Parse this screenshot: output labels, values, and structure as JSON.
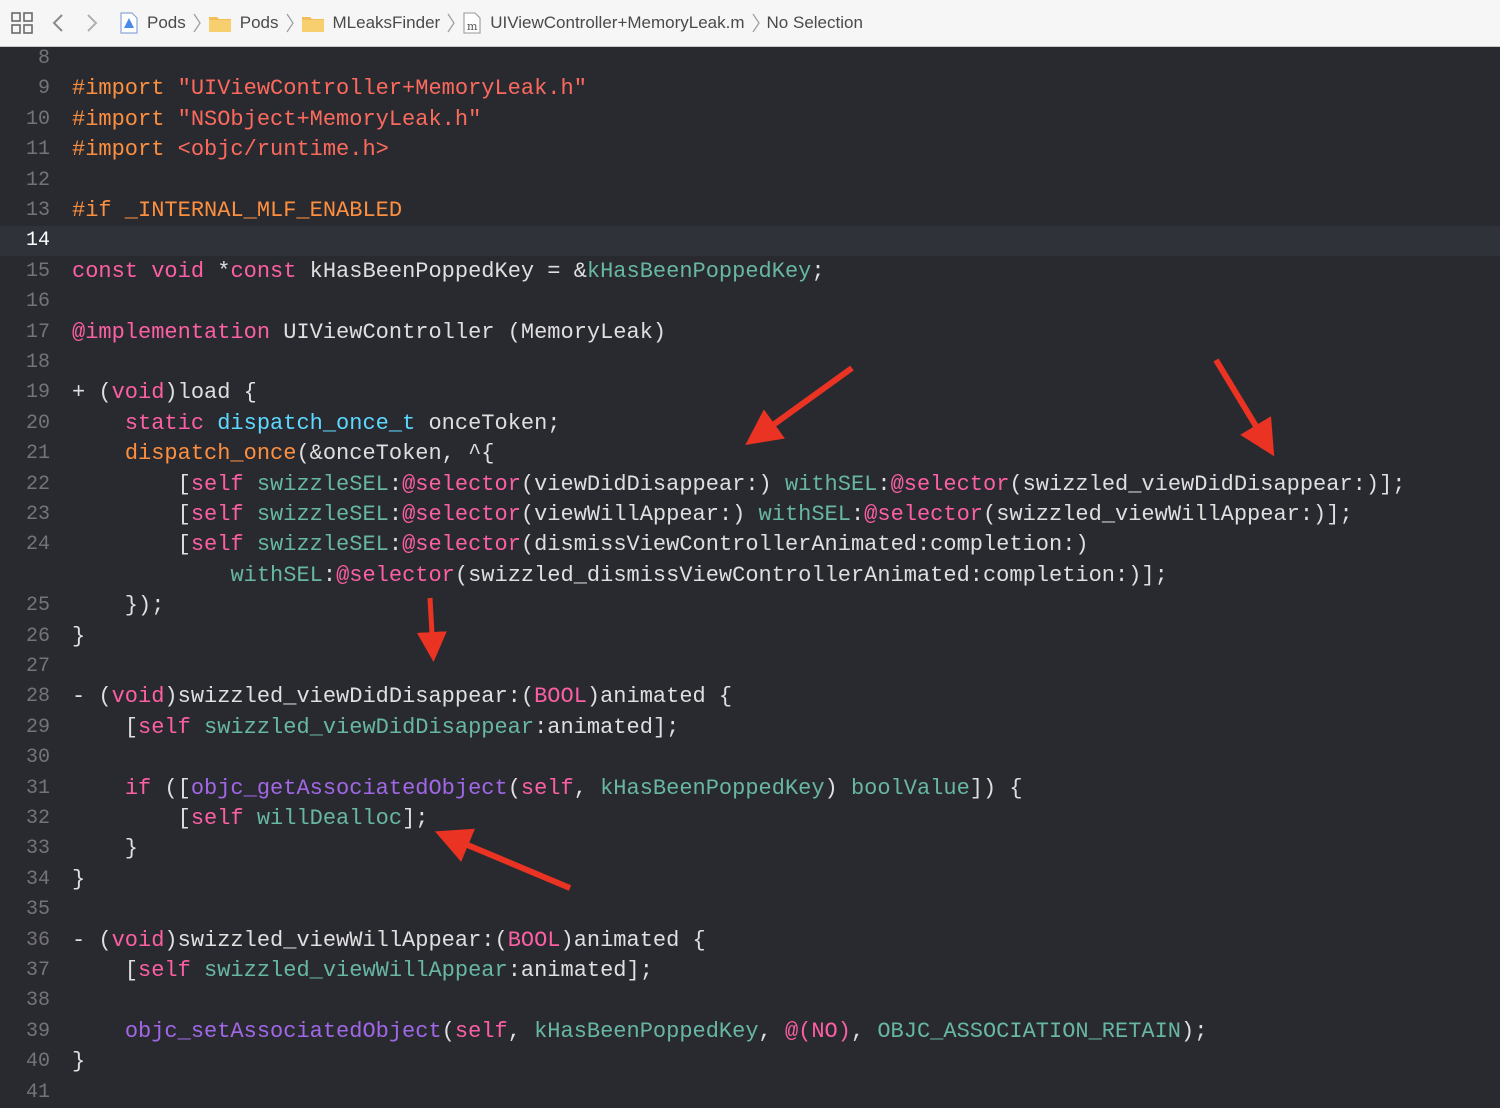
{
  "jumpbar": {
    "crumbs": [
      {
        "label": "Pods",
        "icon": "xcode-project-icon"
      },
      {
        "label": "Pods",
        "icon": "folder-icon"
      },
      {
        "label": "MLeaksFinder",
        "icon": "folder-icon"
      },
      {
        "label": "UIViewController+MemoryLeak.m",
        "icon": "objc-file-icon",
        "icon_letter": "m"
      },
      {
        "label": "No Selection",
        "icon": ""
      }
    ]
  },
  "editor": {
    "current_line": "14",
    "lines": [
      {
        "num": "8",
        "tokens": []
      },
      {
        "num": "9",
        "tokens": [
          [
            "pp",
            "#import "
          ],
          [
            "s",
            "\"UIViewController+MemoryLeak.h\""
          ]
        ]
      },
      {
        "num": "10",
        "tokens": [
          [
            "pp",
            "#import "
          ],
          [
            "s",
            "\"NSObject+MemoryLeak.h\""
          ]
        ]
      },
      {
        "num": "11",
        "tokens": [
          [
            "pp",
            "#import "
          ],
          [
            "s",
            "<objc/runtime.h>"
          ]
        ]
      },
      {
        "num": "12",
        "tokens": []
      },
      {
        "num": "13",
        "tokens": [
          [
            "pp",
            "#if _INTERNAL_MLF_ENABLED"
          ]
        ]
      },
      {
        "num": "14",
        "tokens": []
      },
      {
        "num": "15",
        "tokens": [
          [
            "k",
            "const"
          ],
          [
            "d",
            " "
          ],
          [
            "k",
            "void"
          ],
          [
            "d",
            " *"
          ],
          [
            "k",
            "const"
          ],
          [
            "d",
            " kHasBeenPoppedKey = &"
          ],
          [
            "p",
            "kHasBeenPoppedKey"
          ],
          [
            "d",
            ";"
          ]
        ]
      },
      {
        "num": "16",
        "tokens": []
      },
      {
        "num": "17",
        "tokens": [
          [
            "k",
            "@implementation"
          ],
          [
            "d",
            " UIViewController (MemoryLeak)"
          ]
        ]
      },
      {
        "num": "18",
        "tokens": []
      },
      {
        "num": "19",
        "tokens": [
          [
            "d",
            "+ ("
          ],
          [
            "k",
            "void"
          ],
          [
            "d",
            ")load {"
          ]
        ]
      },
      {
        "num": "20",
        "tokens": [
          [
            "d",
            "    "
          ],
          [
            "k",
            "static"
          ],
          [
            "d",
            " "
          ],
          [
            "t",
            "dispatch_once_t"
          ],
          [
            "d",
            " onceToken;"
          ]
        ]
      },
      {
        "num": "21",
        "tokens": [
          [
            "d",
            "    "
          ],
          [
            "pp",
            "dispatch_once"
          ],
          [
            "d",
            "(&onceToken, ^{"
          ]
        ]
      },
      {
        "num": "22",
        "tokens": [
          [
            "d",
            "        ["
          ],
          [
            "k",
            "self"
          ],
          [
            "d",
            " "
          ],
          [
            "p",
            "swizzleSEL"
          ],
          [
            "d",
            ":"
          ],
          [
            "k",
            "@selector"
          ],
          [
            "d",
            "(viewDidDisappear:) "
          ],
          [
            "p",
            "withSEL"
          ],
          [
            "d",
            ":"
          ],
          [
            "k",
            "@selector"
          ],
          [
            "d",
            "(swizzled_viewDidDisappear:)];"
          ]
        ]
      },
      {
        "num": "23",
        "tokens": [
          [
            "d",
            "        ["
          ],
          [
            "k",
            "self"
          ],
          [
            "d",
            " "
          ],
          [
            "p",
            "swizzleSEL"
          ],
          [
            "d",
            ":"
          ],
          [
            "k",
            "@selector"
          ],
          [
            "d",
            "(viewWillAppear:) "
          ],
          [
            "p",
            "withSEL"
          ],
          [
            "d",
            ":"
          ],
          [
            "k",
            "@selector"
          ],
          [
            "d",
            "(swizzled_viewWillAppear:)];"
          ]
        ]
      },
      {
        "num": "24",
        "tokens": [
          [
            "d",
            "        ["
          ],
          [
            "k",
            "self"
          ],
          [
            "d",
            " "
          ],
          [
            "p",
            "swizzleSEL"
          ],
          [
            "d",
            ":"
          ],
          [
            "k",
            "@selector"
          ],
          [
            "d",
            "(dismissViewControllerAnimated:completion:)"
          ]
        ]
      },
      {
        "num": "",
        "tokens": [
          [
            "d",
            "            "
          ],
          [
            "p",
            "withSEL"
          ],
          [
            "d",
            ":"
          ],
          [
            "k",
            "@selector"
          ],
          [
            "d",
            "(swizzled_dismissViewControllerAnimated:completion:)];"
          ]
        ]
      },
      {
        "num": "25",
        "tokens": [
          [
            "d",
            "    });"
          ]
        ]
      },
      {
        "num": "26",
        "tokens": [
          [
            "d",
            "}"
          ]
        ]
      },
      {
        "num": "27",
        "tokens": []
      },
      {
        "num": "28",
        "tokens": [
          [
            "d",
            "- ("
          ],
          [
            "k",
            "void"
          ],
          [
            "d",
            ")swizzled_viewDidDisappear:("
          ],
          [
            "k",
            "BOOL"
          ],
          [
            "d",
            ")animated {"
          ]
        ]
      },
      {
        "num": "29",
        "tokens": [
          [
            "d",
            "    ["
          ],
          [
            "k",
            "self"
          ],
          [
            "d",
            " "
          ],
          [
            "p",
            "swizzled_viewDidDisappear"
          ],
          [
            "d",
            ":animated];"
          ]
        ]
      },
      {
        "num": "30",
        "tokens": []
      },
      {
        "num": "31",
        "tokens": [
          [
            "d",
            "    "
          ],
          [
            "k",
            "if"
          ],
          [
            "d",
            " (["
          ],
          [
            "f",
            "objc_getAssociatedObject"
          ],
          [
            "d",
            "("
          ],
          [
            "k",
            "self"
          ],
          [
            "d",
            ", "
          ],
          [
            "p",
            "kHasBeenPoppedKey"
          ],
          [
            "d",
            ") "
          ],
          [
            "p",
            "boolValue"
          ],
          [
            "d",
            "]) {"
          ]
        ]
      },
      {
        "num": "32",
        "tokens": [
          [
            "d",
            "        ["
          ],
          [
            "k",
            "self"
          ],
          [
            "d",
            " "
          ],
          [
            "p",
            "willDealloc"
          ],
          [
            "d",
            "];"
          ]
        ]
      },
      {
        "num": "33",
        "tokens": [
          [
            "d",
            "    }"
          ]
        ]
      },
      {
        "num": "34",
        "tokens": [
          [
            "d",
            "}"
          ]
        ]
      },
      {
        "num": "35",
        "tokens": []
      },
      {
        "num": "36",
        "tokens": [
          [
            "d",
            "- ("
          ],
          [
            "k",
            "void"
          ],
          [
            "d",
            ")swizzled_viewWillAppear:("
          ],
          [
            "k",
            "BOOL"
          ],
          [
            "d",
            ")animated {"
          ]
        ]
      },
      {
        "num": "37",
        "tokens": [
          [
            "d",
            "    ["
          ],
          [
            "k",
            "self"
          ],
          [
            "d",
            " "
          ],
          [
            "p",
            "swizzled_viewWillAppear"
          ],
          [
            "d",
            ":animated];"
          ]
        ]
      },
      {
        "num": "38",
        "tokens": []
      },
      {
        "num": "39",
        "tokens": [
          [
            "d",
            "    "
          ],
          [
            "f",
            "objc_setAssociatedObject"
          ],
          [
            "d",
            "("
          ],
          [
            "k",
            "self"
          ],
          [
            "d",
            ", "
          ],
          [
            "p",
            "kHasBeenPoppedKey"
          ],
          [
            "d",
            ", "
          ],
          [
            "k",
            "@("
          ],
          [
            "k",
            "NO"
          ],
          [
            "k",
            ")"
          ],
          [
            "d",
            ", "
          ],
          [
            "p",
            "OBJC_ASSOCIATION_RETAIN"
          ],
          [
            "d",
            ");"
          ]
        ]
      },
      {
        "num": "40",
        "tokens": [
          [
            "d",
            "}"
          ]
        ]
      },
      {
        "num": "41",
        "tokens": []
      }
    ]
  },
  "colors": {
    "background": "#292a30",
    "keyword": "#fc5fa3",
    "preprocessor": "#fd8f3f",
    "string": "#fc6a5d",
    "type": "#5dd8ff",
    "project_identifier": "#67b7a4",
    "library_function": "#a167e6",
    "annotation_arrow": "#ea3323"
  }
}
